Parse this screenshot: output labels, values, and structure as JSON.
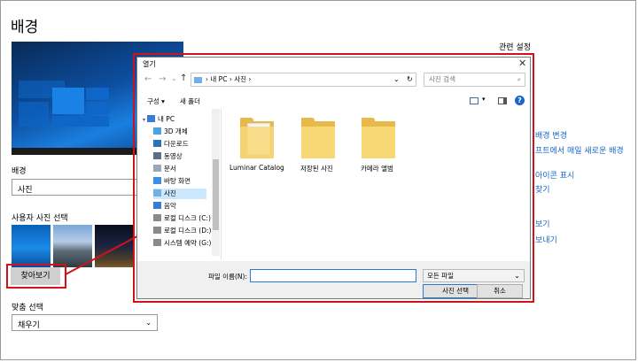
{
  "settings": {
    "title": "배경",
    "related_settings": "관련 설정",
    "background_label": "배경",
    "background_value": "사진",
    "choose_picture_label": "사용자 사진 선택",
    "browse_button": "찾아보기",
    "fit_label": "맞춤 선택",
    "fit_value": "채우기",
    "side_links": [
      "배경 변경",
      "프트에서 매일 새로운 배경",
      "아이콘 표시",
      "찾기",
      "보기",
      "보내기"
    ]
  },
  "dialog": {
    "title": "열기",
    "close_icon": "✕",
    "address": {
      "items": [
        "내 PC",
        "사진"
      ],
      "separator": "›",
      "dropdown_glyph": "⌄",
      "refresh_glyph": "↻"
    },
    "search_placeholder": "사진 검색",
    "toolbar": {
      "organize": "구성 ▾",
      "new_folder": "새 폴더",
      "help_glyph": "?"
    },
    "nav_items": [
      {
        "label": "내 PC",
        "icon": "computer-icon",
        "color": "#3a7bd5"
      },
      {
        "label": "3D 개체",
        "icon": "cube-icon",
        "color": "#4aa3df"
      },
      {
        "label": "다운로드",
        "icon": "download-icon",
        "color": "#2c6fbd"
      },
      {
        "label": "동영상",
        "icon": "video-icon",
        "color": "#5b6f86"
      },
      {
        "label": "문서",
        "icon": "document-icon",
        "color": "#9aa8b6"
      },
      {
        "label": "바탕 화면",
        "icon": "desktop-icon",
        "color": "#3a8ee6"
      },
      {
        "label": "사진",
        "icon": "pictures-icon",
        "color": "#6fb0e8"
      },
      {
        "label": "음악",
        "icon": "music-icon",
        "color": "#3a7bd5"
      },
      {
        "label": "로컬 디스크 (C:)",
        "icon": "drive-icon",
        "color": "#8a8a8a"
      },
      {
        "label": "로컬 디스크 (D:)",
        "icon": "drive-icon",
        "color": "#8a8a8a"
      },
      {
        "label": "시스템 예약 (G:)",
        "icon": "drive-icon",
        "color": "#8a8a8a"
      }
    ],
    "folders": [
      {
        "label": "Luminar Catalog"
      },
      {
        "label": "저장된 사진"
      },
      {
        "label": "카메라 앨범"
      }
    ],
    "filename_label": "파일 이름(N):",
    "filename_value": "",
    "filter_value": "모든 파일",
    "open_button": "사진 선택",
    "cancel_button": "취소"
  },
  "colors": {
    "highlight": "#d0121b",
    "link": "#1a67c8",
    "folder": "#f8d775",
    "selection": "#cce8ff"
  }
}
